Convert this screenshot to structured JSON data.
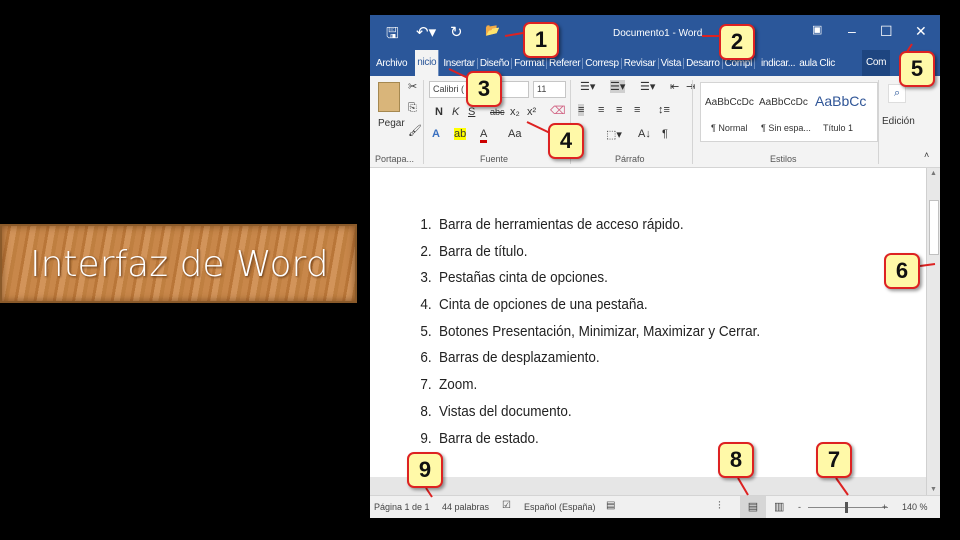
{
  "slide_title": "Interfaz de Word",
  "window": {
    "title": "Documento1 - Word",
    "tabs": [
      "Archivo",
      "nicio",
      "Insertar",
      "Diseño",
      "Format",
      "Referer",
      "Corresp",
      "Revisar",
      "Vista",
      "Desarro",
      "Compl",
      "indicar...",
      "aula Clic",
      "Com"
    ],
    "ribbon": {
      "font_name": "Calibri (",
      "font_size": "11",
      "paste_label": "Pegar",
      "font_buttons": [
        "N",
        "K",
        "S",
        "abc",
        "x₂",
        "x²"
      ],
      "case_btn": "Aa",
      "styles": [
        {
          "preview": "AaBbCcDc",
          "name": "¶ Normal"
        },
        {
          "preview": "AaBbCcDc",
          "name": "¶ Sin espa..."
        },
        {
          "preview": "AaBbCc",
          "name": "Título 1"
        }
      ],
      "edit_label": "Edición",
      "groups": [
        "Portapa...",
        "Fuente",
        "Párrafo",
        "Estilos"
      ]
    },
    "list": [
      "Barra de herramientas de acceso rápido.",
      "Barra de título.",
      "Pestañas cinta de opciones.",
      "Cinta de opciones de una pestaña.",
      "Botones  Presentación, Minimizar, Maximizar y Cerrar.",
      "Barras de desplazamiento.",
      "Zoom.",
      "Vistas del documento.",
      "Barra de estado."
    ],
    "status": {
      "page": "Página 1 de 1",
      "words": "44 palabras",
      "language": "Español (España)",
      "zoom": "140 %"
    }
  },
  "callouts": [
    "1",
    "2",
    "3",
    "4",
    "5",
    "6",
    "7",
    "8",
    "9"
  ],
  "colors": {
    "title_bar": "#2b579a",
    "callout_fill": "#fff9a8",
    "callout_border": "#dd2222"
  }
}
